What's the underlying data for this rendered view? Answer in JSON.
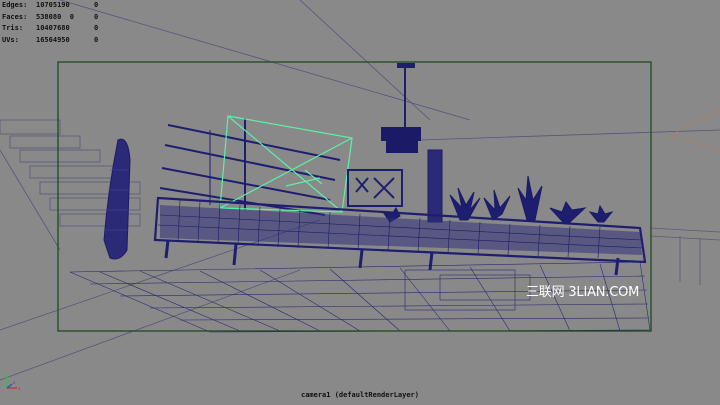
{
  "hud": {
    "rows": [
      {
        "label": "Edges:",
        "total": "10705190",
        "selected": "0"
      },
      {
        "label": "Faces:",
        "total": "538080  0",
        "selected": "0"
      },
      {
        "label": "Tris:",
        "total": "10407680",
        "selected": "0"
      },
      {
        "label": "UVs:",
        "total": "16564950",
        "selected": "0"
      }
    ]
  },
  "viewport": {
    "camera_label": "camera1 (defaultRenderLayer)",
    "watermark": "三联网 3LIAN.COM"
  },
  "axis": {
    "x_label": "x",
    "y_label": "y",
    "z_label": "z"
  },
  "colors": {
    "background": "#898989",
    "wireframe": "#1e1e70",
    "selected_wire": "#5cf0a8",
    "gate": "#1f4a1f"
  }
}
